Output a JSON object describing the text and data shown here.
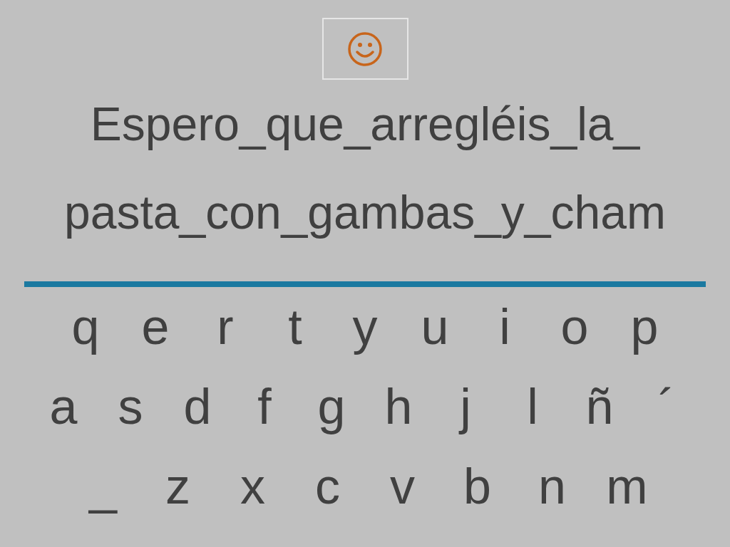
{
  "sentence": [
    "Espero_que_arregléis_la_",
    "pasta_con_gambas_y_cham"
  ],
  "keyboard": {
    "rows": [
      [
        "q",
        "e",
        "r",
        "t",
        "y",
        "u",
        "i",
        "o",
        "p"
      ],
      [
        "a",
        "s",
        "d",
        "f",
        "g",
        "h",
        "j",
        "l",
        "ñ",
        "´"
      ],
      [
        "_",
        "z",
        "x",
        "c",
        "v",
        "b",
        "n",
        "m"
      ]
    ]
  }
}
